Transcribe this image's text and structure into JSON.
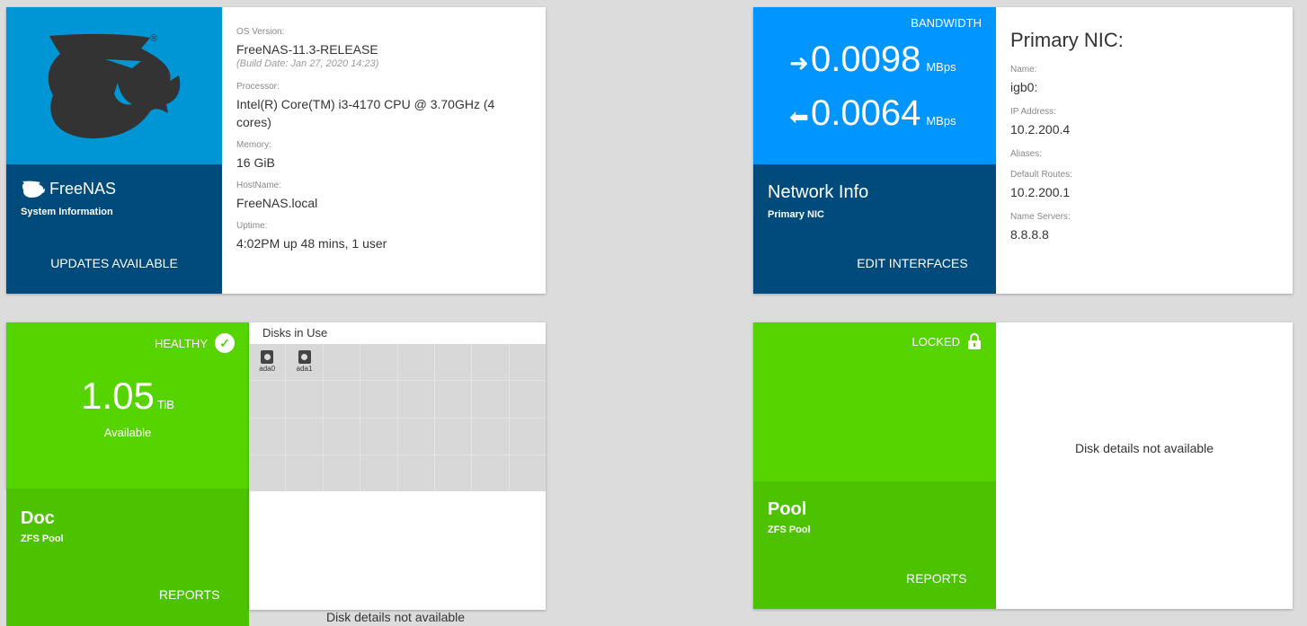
{
  "system": {
    "brand": "FreeNAS",
    "brand_sub": "System Information",
    "updates_label": "UPDATES AVAILABLE",
    "fields": {
      "os_label": "OS Version:",
      "os_value": "FreeNAS-11.3-RELEASE",
      "build_date": "(Build Date: Jan 27, 2020 14:23)",
      "processor_label": "Processor:",
      "processor_value": "Intel(R) Core(TM) i3-4170 CPU @ 3.70GHz (4 cores)",
      "memory_label": "Memory:",
      "memory_value": "16 GiB",
      "hostname_label": "HostName:",
      "hostname_value": "FreeNAS.local",
      "uptime_label": "Uptime:",
      "uptime_value": "4:02PM up 48 mins, 1 user"
    },
    "colors": {
      "logo_bg": "#0095d5",
      "dark_bg": "#004b7c"
    }
  },
  "network": {
    "bandwidth_label": "BANDWIDTH",
    "tx_value": "0.0098",
    "rx_value": "0.0064",
    "unit": "MBps",
    "title": "Network Info",
    "subtitle": "Primary NIC",
    "edit_label": "EDIT INTERFACES",
    "nic_title": "Primary NIC:",
    "name_label": "Name:",
    "name_value": "igb0:",
    "ip_label": "IP Address:",
    "ip_value": "10.2.200.4",
    "aliases_label": "Aliases:",
    "routes_label": "Default Routes:",
    "routes_value": "10.2.200.1",
    "dns_label": "Name Servers:",
    "dns_value": "8.8.8.8",
    "colors": {
      "blue": "#0095ff",
      "dark": "#004b7c"
    }
  },
  "pool_doc": {
    "status": "HEALTHY",
    "available_value": "1.05",
    "available_unit": "TiB",
    "available_label": "Available",
    "name": "Doc",
    "type": "ZFS Pool",
    "reports_label": "REPORTS",
    "disks_title": "Disks in Use",
    "disks": [
      "ada0",
      "ada1"
    ],
    "disk_details_na": "Disk details not available",
    "colors": {
      "green": "#55d400",
      "green_dark": "#4cc200"
    }
  },
  "pool_locked": {
    "status": "LOCKED",
    "name": "Pool",
    "type": "ZFS Pool",
    "reports_label": "REPORTS",
    "disk_details_na": "Disk details not available"
  }
}
